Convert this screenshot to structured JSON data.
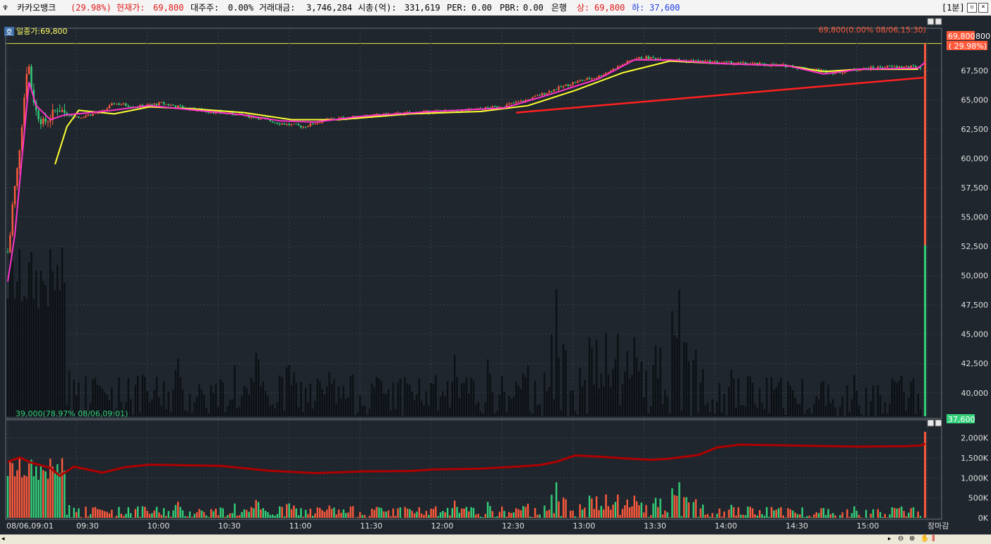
{
  "header": {
    "icon": "chart-icon",
    "name": "카카오뱅크",
    "change_pct": "(29.98%)",
    "price_label": "현재가:",
    "price": "69,800",
    "major_label": "대주주:",
    "major": "0.00%",
    "turnover_label": "거래대금:",
    "turnover": "3,746,284",
    "mcap_label": "시총(억):",
    "mcap": "331,619",
    "per_label": "PER:",
    "per": "0.00",
    "pbr_label": "PBR:",
    "pbr": "0.00",
    "sector": "은행",
    "upper_label": "상:",
    "upper": "69,800",
    "lower_label": "하:",
    "lower": "37,600",
    "interval": "[1분]"
  },
  "colors": {
    "up": "#ff5a3c",
    "down": "#33d17a",
    "ma_short": "#ff33cc",
    "ma_long": "#ffff33",
    "trend": "#ff2020",
    "volume_line": "#b00000"
  },
  "chart_data": [
    {
      "type": "candlestick",
      "title": "",
      "ref_label": "일종가:69,800",
      "ref_value": 69800,
      "badge": "호",
      "high_annotation": "69,800(0.00% 08/06,15:30)",
      "low_annotation": "39,000(78.97% 08/06,09:01)",
      "price_tag": "69,800",
      "price_tag_extra": "800",
      "change_tag": "( 29.98%)",
      "low_tag": "37,600",
      "y_ticks": [
        "67,500",
        "65,000",
        "62,500",
        "60,000",
        "57,500",
        "55,000",
        "52,500",
        "50,000",
        "47,500",
        "45,000",
        "42,500",
        "40,000"
      ],
      "y_values": [
        67500,
        65000,
        62500,
        60000,
        57500,
        55000,
        52500,
        50000,
        47500,
        45000,
        42500,
        40000
      ],
      "ylim": [
        38000,
        70500
      ],
      "x_ticks": [
        "08/06,09:01",
        "09:30",
        "10:00",
        "10:30",
        "11:00",
        "11:30",
        "12:00",
        "12:30",
        "13:00",
        "13:30",
        "14:00",
        "14:30",
        "15:00",
        "장마감"
      ],
      "x_minutes": [
        0,
        29,
        59,
        89,
        119,
        149,
        179,
        209,
        239,
        269,
        299,
        329,
        359,
        389
      ],
      "price_series": [
        [
          0,
          52000
        ],
        [
          1,
          53500
        ],
        [
          2,
          56000
        ],
        [
          4,
          59000
        ],
        [
          6,
          63000
        ],
        [
          8,
          67500
        ],
        [
          9,
          67800
        ],
        [
          10,
          66000
        ],
        [
          12,
          64000
        ],
        [
          15,
          63000
        ],
        [
          18,
          63500
        ],
        [
          21,
          64300
        ],
        [
          25,
          63800
        ],
        [
          30,
          63500
        ],
        [
          40,
          64000
        ],
        [
          45,
          64700
        ],
        [
          55,
          64400
        ],
        [
          65,
          64700
        ],
        [
          75,
          64300
        ],
        [
          85,
          64000
        ],
        [
          95,
          63800
        ],
        [
          105,
          63500
        ],
        [
          115,
          63000
        ],
        [
          125,
          62700
        ],
        [
          135,
          63300
        ],
        [
          150,
          63600
        ],
        [
          165,
          63800
        ],
        [
          180,
          64000
        ],
        [
          190,
          64000
        ],
        [
          200,
          64200
        ],
        [
          210,
          64500
        ],
        [
          220,
          65000
        ],
        [
          230,
          65800
        ],
        [
          240,
          66500
        ],
        [
          250,
          67000
        ],
        [
          260,
          68000
        ],
        [
          265,
          68500
        ],
        [
          270,
          68600
        ],
        [
          280,
          68400
        ],
        [
          290,
          68300
        ],
        [
          300,
          68200
        ],
        [
          310,
          68100
        ],
        [
          320,
          68000
        ],
        [
          330,
          67900
        ],
        [
          340,
          67600
        ],
        [
          350,
          67300
        ],
        [
          360,
          67600
        ],
        [
          370,
          67800
        ],
        [
          380,
          67800
        ],
        [
          386,
          67800
        ]
      ],
      "ma_short": [
        [
          0,
          49500
        ],
        [
          3,
          53500
        ],
        [
          6,
          60000
        ],
        [
          9,
          66500
        ],
        [
          12,
          64500
        ],
        [
          18,
          63300
        ],
        [
          24,
          63700
        ],
        [
          40,
          64000
        ],
        [
          60,
          64500
        ],
        [
          80,
          64100
        ],
        [
          100,
          63700
        ],
        [
          115,
          63200
        ],
        [
          130,
          63100
        ],
        [
          150,
          63600
        ],
        [
          180,
          64000
        ],
        [
          210,
          64300
        ],
        [
          230,
          65500
        ],
        [
          250,
          66800
        ],
        [
          265,
          68400
        ],
        [
          280,
          68400
        ],
        [
          300,
          68100
        ],
        [
          330,
          67900
        ],
        [
          345,
          67200
        ],
        [
          360,
          67600
        ],
        [
          385,
          67700
        ],
        [
          388,
          68200
        ]
      ],
      "ma_long": [
        [
          20,
          59500
        ],
        [
          25,
          62700
        ],
        [
          30,
          64100
        ],
        [
          45,
          63800
        ],
        [
          60,
          64400
        ],
        [
          80,
          64200
        ],
        [
          100,
          63900
        ],
        [
          120,
          63300
        ],
        [
          140,
          63300
        ],
        [
          170,
          63800
        ],
        [
          200,
          64000
        ],
        [
          220,
          64500
        ],
        [
          240,
          65800
        ],
        [
          260,
          67300
        ],
        [
          280,
          68300
        ],
        [
          300,
          68100
        ],
        [
          330,
          67900
        ],
        [
          345,
          67400
        ],
        [
          360,
          67600
        ],
        [
          385,
          67600
        ]
      ],
      "trend_line": [
        [
          215,
          63900
        ],
        [
          388,
          66900
        ]
      ]
    },
    {
      "type": "bar",
      "title": "",
      "y_ticks": [
        "2,000K",
        "1,500K",
        "1,000K",
        "500K",
        "0K"
      ],
      "y_values": [
        2000,
        1500,
        1000,
        500,
        0
      ],
      "ylim": [
        0,
        2150
      ],
      "cum_line": [
        [
          0,
          1400
        ],
        [
          5,
          1510
        ],
        [
          10,
          1380
        ],
        [
          18,
          1250
        ],
        [
          22,
          1050
        ],
        [
          28,
          1280
        ],
        [
          40,
          1130
        ],
        [
          50,
          1270
        ],
        [
          60,
          1330
        ],
        [
          90,
          1300
        ],
        [
          100,
          1240
        ],
        [
          110,
          1180
        ],
        [
          130,
          1120
        ],
        [
          150,
          1160
        ],
        [
          170,
          1170
        ],
        [
          180,
          1210
        ],
        [
          200,
          1230
        ],
        [
          215,
          1280
        ],
        [
          225,
          1320
        ],
        [
          232,
          1400
        ],
        [
          240,
          1560
        ],
        [
          250,
          1530
        ],
        [
          260,
          1490
        ],
        [
          272,
          1450
        ],
        [
          280,
          1480
        ],
        [
          292,
          1570
        ],
        [
          300,
          1760
        ],
        [
          310,
          1830
        ],
        [
          340,
          1800
        ],
        [
          360,
          1780
        ],
        [
          380,
          1790
        ],
        [
          386,
          1810
        ],
        [
          388,
          1850
        ]
      ]
    }
  ]
}
